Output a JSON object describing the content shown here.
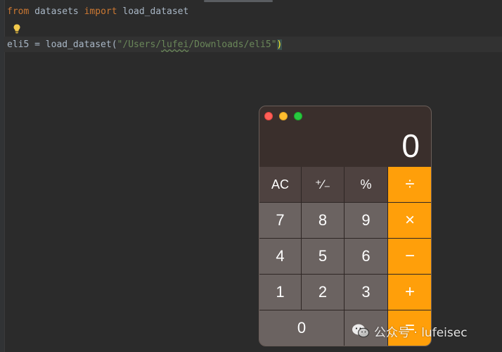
{
  "editor": {
    "line1": {
      "kw_from": "from",
      "module": " datasets ",
      "kw_import": "import",
      "name": " load_dataset"
    },
    "line3": {
      "lhs": "eli5 = load_dataset(",
      "str_open": "\"/Users/",
      "str_typo": "lufei",
      "str_rest": "/Downloads/eli5\"",
      "paren": ")"
    },
    "intention_icon": "lightbulb-icon"
  },
  "calculator": {
    "display": "0",
    "keys": {
      "ac": "AC",
      "sign": "⁺∕₋",
      "percent": "%",
      "divide": "÷",
      "seven": "7",
      "eight": "8",
      "nine": "9",
      "multiply": "×",
      "four": "4",
      "five": "5",
      "six": "6",
      "minus": "−",
      "one": "1",
      "two": "2",
      "three": "3",
      "plus": "+",
      "zero": "0",
      "decimal": ".",
      "equals": "="
    },
    "colors": {
      "operator": "#ff9f0a",
      "number": "#6b6361",
      "function": "#4e4240"
    }
  },
  "watermark": {
    "text": "公众号 · lufeisec",
    "icon": "wechat-icon"
  }
}
